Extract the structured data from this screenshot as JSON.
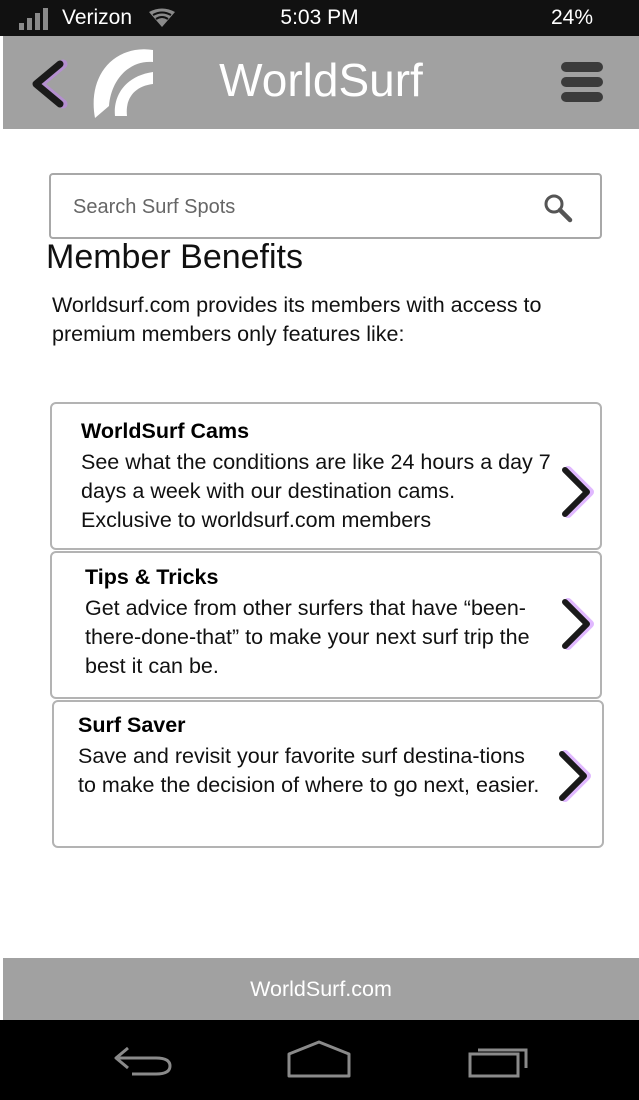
{
  "status_bar": {
    "carrier": "Verizon",
    "time": "5:03 PM",
    "battery": "24%"
  },
  "header": {
    "title": "WorldSurf",
    "icons": {
      "back": "chevron-left-icon",
      "logo": "worldsurf-wave-logo",
      "menu": "hamburger-menu-icon"
    }
  },
  "search": {
    "placeholder": "Search Surf Spots",
    "value": "",
    "icon": "search-icon"
  },
  "main": {
    "section_title": "Member Benefits",
    "intro": "Worldsurf.com provides its members with access to premium members only features like:",
    "cards": [
      {
        "title": "WorldSurf Cams",
        "description": "See what the conditions are like 24 hours a day 7 days a week with our destination cams. Exclusive to worldsurf.com members"
      },
      {
        "title": "Tips & Tricks",
        "description": "Get advice from other surfers that have “been-there-done-that” to make your next surf trip the best it can be."
      },
      {
        "title": "Surf Saver",
        "description": "Save and revisit your favorite surf destina-tions to make the decision of where to go next, easier."
      }
    ]
  },
  "footer": {
    "text": "WorldSurf.com"
  },
  "colors": {
    "header_bg": "#a1a1a1",
    "chevron": "#1a1a1a",
    "chevron_glow": "#c77dff",
    "status_bar_bg": "#111111"
  }
}
